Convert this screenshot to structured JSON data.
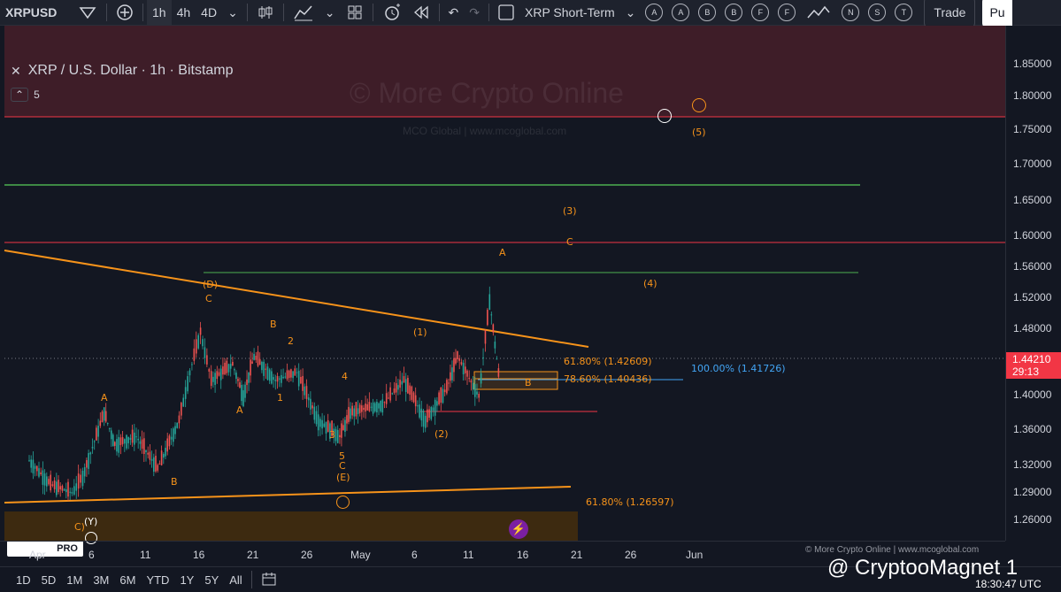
{
  "topbar": {
    "symbol": "XRPUSD",
    "intervals": [
      "1h",
      "4h",
      "4D"
    ],
    "active_interval": "1h",
    "template_name": "XRP Short-Term",
    "circle_letters": [
      "A",
      "A",
      "B",
      "B",
      "F",
      "F",
      "N",
      "S",
      "T"
    ],
    "trade_label": "Trade",
    "publish_label": "Pu"
  },
  "legend": {
    "title": "XRP / U.S. Dollar · 1h · Bitstamp",
    "indicator_count": "5"
  },
  "watermark": {
    "main": "© More Crypto Online",
    "sub": "MCO Global   |   www.mcoglobal.com"
  },
  "copyright": "© More Crypto Online   |   www.mcoglobal.com",
  "tv_logo_text": "PRO",
  "price_axis": {
    "ticks": [
      "1.85000",
      "1.80000",
      "1.75000",
      "1.70000",
      "1.65000",
      "1.60000",
      "1.56000",
      "1.52000",
      "1.48000",
      "1.44210",
      "1.40000",
      "1.36000",
      "1.32000",
      "1.29000",
      "1.26000"
    ],
    "current_price": "1.44210",
    "countdown": "29:13"
  },
  "time_axis": {
    "ticks": [
      "Apr",
      "6",
      "11",
      "16",
      "21",
      "26",
      "May",
      "6",
      "11",
      "16",
      "21",
      "26",
      "Jun"
    ]
  },
  "bottombar": {
    "ranges": [
      "1D",
      "5D",
      "1M",
      "3M",
      "6M",
      "YTD",
      "1Y",
      "5Y",
      "All"
    ],
    "clock": "18:30:47 UTC"
  },
  "overlay_credit": "@ CryptooMagnet 1",
  "fib_labels": {
    "f1": "61.80% (1.42609)",
    "f2": "78.60% (1.40436)",
    "f3": "100.00% (1.41726)",
    "f4": "61.80% (1.26597)"
  },
  "wave_labels": [
    "(D)",
    "C",
    "B",
    "2",
    "A",
    "1",
    "4",
    "3",
    "5",
    "C",
    "(E)",
    "A",
    "B",
    "(1)",
    "(2)",
    "A",
    "B",
    "(3)",
    "C",
    "(4)",
    "(5)",
    "(Y)",
    "C)"
  ],
  "colors": {
    "accent": "#f7931a",
    "bull": "#26a69a",
    "bear": "#ef5350",
    "price_tag": "#f23645"
  },
  "chart_data": {
    "type": "candlestick",
    "series_points": [
      [
        "Apr 1",
        1.34
      ],
      [
        "Apr 3",
        1.31
      ],
      [
        "Apr 5",
        1.3
      ],
      [
        "Apr 6",
        1.32
      ],
      [
        "Apr 8",
        1.4
      ],
      [
        "Apr 9",
        1.36
      ],
      [
        "Apr 11",
        1.37
      ],
      [
        "Apr 13",
        1.33
      ],
      [
        "Apr 15",
        1.39
      ],
      [
        "Apr 16",
        1.45
      ],
      [
        "Apr 17",
        1.5
      ],
      [
        "Apr 18",
        1.44
      ],
      [
        "Apr 20",
        1.46
      ],
      [
        "Apr 21",
        1.42
      ],
      [
        "Apr 22",
        1.47
      ],
      [
        "Apr 24",
        1.44
      ],
      [
        "Apr 26",
        1.45
      ],
      [
        "Apr 28",
        1.39
      ],
      [
        "Apr 30",
        1.37
      ],
      [
        "May 1",
        1.4
      ],
      [
        "May 4",
        1.41
      ],
      [
        "May 6",
        1.44
      ],
      [
        "May 8",
        1.39
      ],
      [
        "May 10",
        1.43
      ],
      [
        "May 11",
        1.47
      ],
      [
        "May 13",
        1.42
      ],
      [
        "May 14",
        1.54
      ],
      [
        "May 15",
        1.43
      ]
    ],
    "levels": [
      1.79,
      1.67,
      1.59,
      1.555,
      1.38
    ],
    "ylim": [
      1.24,
      1.86
    ]
  }
}
